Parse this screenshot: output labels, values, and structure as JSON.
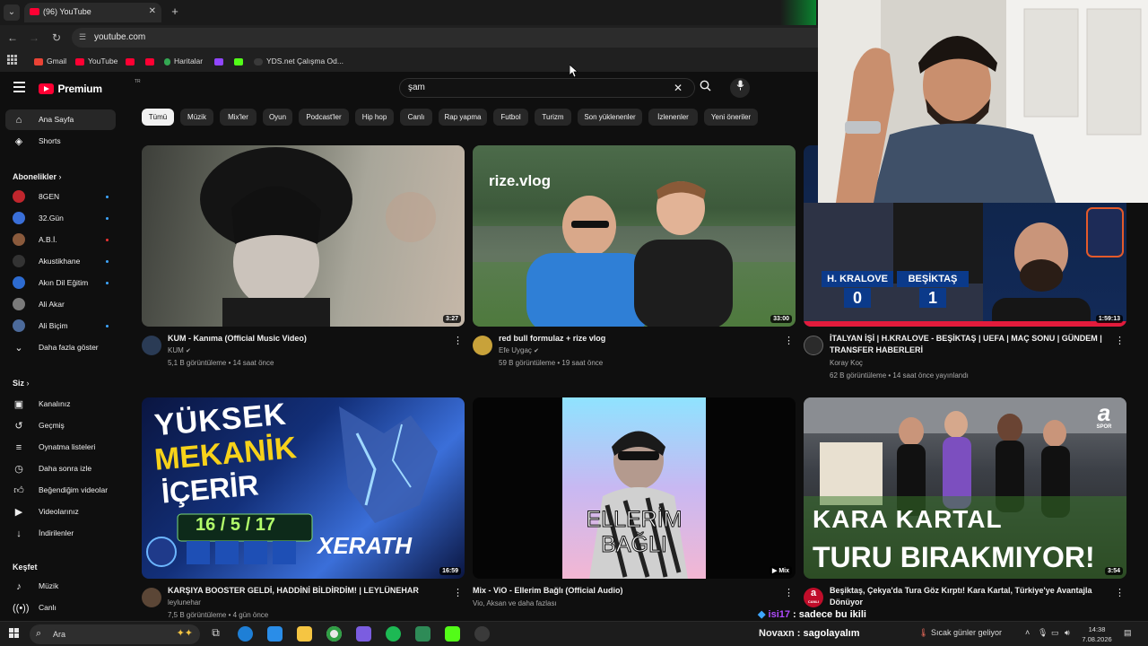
{
  "browser": {
    "tab_title": "(96) YouTube",
    "url": "youtube.com",
    "bookmarks": [
      "Gmail",
      "YouTube",
      "Haritalar",
      "YDS.net Çalışma Od..."
    ]
  },
  "header": {
    "logo_text": "Premium",
    "logo_suffix": "TR",
    "search_query": "şam"
  },
  "sidebar": {
    "main": [
      {
        "label": "Ana Sayfa",
        "icon": "home-icon"
      },
      {
        "label": "Shorts",
        "icon": "shorts-icon"
      }
    ],
    "subscriptions_title": "Abonelikler",
    "subscriptions": [
      {
        "label": "8GEN",
        "color": "#c0262d"
      },
      {
        "label": "32.Gün",
        "color": "#3a6fd8"
      },
      {
        "label": "A.B.İ.",
        "color": "#8a5a3c"
      },
      {
        "label": "Akustikhane",
        "color": "#333333"
      },
      {
        "label": "Akın Dil Eğitim",
        "color": "#2d6bd0"
      },
      {
        "label": "Ali Akar",
        "color": "#7a7a7a"
      },
      {
        "label": "Ali Biçim",
        "color": "#4c6a9a"
      }
    ],
    "show_more": "Daha fazla göster",
    "you_title": "Siz",
    "you_items": [
      {
        "label": "Kanalınız",
        "icon": "channel-icon"
      },
      {
        "label": "Geçmiş",
        "icon": "history-icon"
      },
      {
        "label": "Oynatma listeleri",
        "icon": "playlist-icon"
      },
      {
        "label": "Daha sonra izle",
        "icon": "watch-later-icon"
      },
      {
        "label": "Beğendiğim videolar",
        "icon": "like-icon"
      },
      {
        "label": "Videolarınız",
        "icon": "your-videos-icon"
      },
      {
        "label": "İndirilenler",
        "icon": "download-icon"
      }
    ],
    "explore_title": "Keşfet",
    "explore_items": [
      {
        "label": "Müzik",
        "icon": "music-icon"
      },
      {
        "label": "Canlı",
        "icon": "live-icon"
      }
    ]
  },
  "chips": [
    "Tümü",
    "Müzik",
    "Mix'ler",
    "Oyun",
    "Podcast'ler",
    "Hip hop",
    "Canlı",
    "Rap yapma",
    "Futbol",
    "Turizm",
    "Son yüklenenler",
    "İzlenenler",
    "Yeni öneriler"
  ],
  "videos": [
    {
      "title": "KUM - Kanıma (Official Music Video)",
      "channel": "KUM",
      "meta": "5,1 B görüntüleme • 14 saat önce",
      "duration": "3:27"
    },
    {
      "title": "red bull formulaz + rize vlog",
      "channel": "Efe Uygaç",
      "meta": "59 B görüntüleme • 19 saat önce",
      "duration": "33:00",
      "overlay": "rize.vlog"
    },
    {
      "title": "İTALYAN İŞİ | H.KRALOVE - BEŞİKTAŞ | UEFA | MAÇ SONU | GÜNDEM | TRANSFER HABERLERİ",
      "channel": "Koray Koç",
      "meta": "62 B görüntüleme • 14 saat önce yayınlandı",
      "duration": "1:59:13",
      "score_left": "H. KRALOVE",
      "score_right": "BEŞİKTAŞ",
      "score_left_val": "0",
      "score_right_val": "1"
    },
    {
      "title": "KARŞIYA BOOSTER GELDİ, HADDİNİ BİLDİRDİM! | LEYLÜNEHAR",
      "channel": "leylunehar",
      "meta": "7,5 B görüntüleme • 4 gün önce",
      "duration": "16:59",
      "line1": "YÜKSEK",
      "line2": "MEKANİK",
      "line3": "İÇERİR",
      "stats": "16 / 5 / 17",
      "champion": "XERATH"
    },
    {
      "title": "Mix - ViO - Ellerim Bağlı (Official Audio)",
      "channel": "Vio, Aksan ve daha fazlası",
      "meta": "",
      "duration": "Mix",
      "art_line1": "ELLERİM",
      "art_line2": "BAĞLI"
    },
    {
      "title": "Beşiktaş, Çekya'da Tura Göz Kırptı! Kara Kartal, Türkiye'ye Avantajla Dönüyor",
      "channel": "",
      "meta": "",
      "duration": "3:54",
      "headline1": "KARA KARTAL",
      "headline2": "TURU BIRAKMIYOR!",
      "badge": "a",
      "badge_sub": "CANLI",
      "brand": "a",
      "brand_sub": "SPOR"
    }
  ],
  "chat": [
    {
      "user": "isi17",
      "sep": " : ",
      "text": "sadece bu ikili",
      "user_color": "#b04bff"
    },
    {
      "user": "Novaxn",
      "sep": " : ",
      "text": "sagolayalım",
      "user_color": "#f0f0f0"
    }
  ],
  "taskbar": {
    "search_label": "Ara",
    "weather": "Sıcak günler geliyor",
    "time": "14:38",
    "date": "7.08.2026"
  }
}
